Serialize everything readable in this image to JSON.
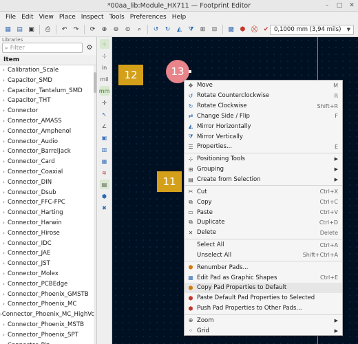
{
  "window": {
    "title": "*00aa_lib:Module_HX711 — Footprint Editor"
  },
  "menubar": [
    "File",
    "Edit",
    "View",
    "Place",
    "Inspect",
    "Tools",
    "Preferences",
    "Help"
  ],
  "toolbar": {
    "grid_value": "0,1000 mm (3,94 mils)"
  },
  "libraries": {
    "panel_title": "Libraries",
    "filter_placeholder": "Filter",
    "column_header": "Item",
    "items": [
      "Calibration_Scale",
      "Capacitor_SMD",
      "Capacitor_Tantalum_SMD",
      "Capacitor_THT",
      "Connector",
      "Connector_AMASS",
      "Connector_Amphenol",
      "Connector_Audio",
      "Connector_BarrelJack",
      "Connector_Card",
      "Connector_Coaxial",
      "Connector_DIN",
      "Connector_Dsub",
      "Connector_FFC-FPC",
      "Connector_Harting",
      "Connector_Harwin",
      "Connector_Hirose",
      "Connector_IDC",
      "Connector_JAE",
      "Connector_JST",
      "Connector_Molex",
      "Connector_PCBEdge",
      "Connector_Phoenix_GMSTB",
      "Connector_Phoenix_MC",
      "Connector_Phoenix_MC_HighVoltage",
      "Connector_Phoenix_MSTB",
      "Connector_Phoenix_SPT",
      "Connector_Pin"
    ]
  },
  "canvas": {
    "pads": [
      "12",
      "13",
      "11"
    ]
  },
  "context_menu": {
    "items": [
      {
        "label": "Move",
        "shortcut": "M",
        "icon": "move-icon"
      },
      {
        "label": "Rotate Counterclockwise",
        "shortcut": "R",
        "icon": "rotate-ccw-icon"
      },
      {
        "label": "Rotate Clockwise",
        "shortcut": "Shift+R",
        "icon": "rotate-cw-icon"
      },
      {
        "label": "Change Side / Flip",
        "shortcut": "F",
        "icon": "flip-icon"
      },
      {
        "label": "Mirror Horizontally",
        "shortcut": "",
        "icon": "mirror-h-icon"
      },
      {
        "label": "Mirror Vertically",
        "shortcut": "",
        "icon": "mirror-v-icon"
      },
      {
        "label": "Properties...",
        "shortcut": "E",
        "icon": "properties-icon"
      },
      {
        "sep": true
      },
      {
        "label": "Positioning Tools",
        "submenu": true,
        "icon": "positioning-icon"
      },
      {
        "label": "Grouping",
        "submenu": true,
        "icon": "grouping-icon"
      },
      {
        "label": "Create from Selection",
        "submenu": true,
        "icon": "create-selection-icon"
      },
      {
        "sep": true
      },
      {
        "label": "Cut",
        "shortcut": "Ctrl+X",
        "icon": "cut-icon"
      },
      {
        "label": "Copy",
        "shortcut": "Ctrl+C",
        "icon": "copy-icon"
      },
      {
        "label": "Paste",
        "shortcut": "Ctrl+V",
        "icon": "paste-icon"
      },
      {
        "label": "Duplicate",
        "shortcut": "Ctrl+D",
        "icon": "duplicate-icon"
      },
      {
        "label": "Delete",
        "shortcut": "Delete",
        "icon": "delete-icon"
      },
      {
        "sep": true
      },
      {
        "label": "Select All",
        "shortcut": "Ctrl+A",
        "icon": ""
      },
      {
        "label": "Unselect All",
        "shortcut": "Shift+Ctrl+A",
        "icon": ""
      },
      {
        "sep": true
      },
      {
        "label": "Renumber Pads...",
        "shortcut": "",
        "icon": "renumber-icon"
      },
      {
        "label": "Edit Pad as Graphic Shapes",
        "shortcut": "Ctrl+E",
        "icon": "edit-pad-icon"
      },
      {
        "label": "Copy Pad Properties to Default",
        "shortcut": "",
        "icon": "copy-pad-icon",
        "highlighted": true
      },
      {
        "label": "Paste Default Pad Properties to Selected",
        "shortcut": "",
        "icon": "paste-pad-icon"
      },
      {
        "label": "Push Pad Properties to Other Pads...",
        "shortcut": "",
        "icon": "push-pad-icon"
      },
      {
        "sep": true
      },
      {
        "label": "Zoom",
        "submenu": true,
        "icon": "zoom-icon"
      },
      {
        "label": "Grid",
        "submenu": true,
        "icon": "grid-icon"
      }
    ]
  },
  "colors": {
    "canvas_bg": "#001023",
    "pad": "#d4a01a",
    "pad_highlight": "#e8848a"
  }
}
